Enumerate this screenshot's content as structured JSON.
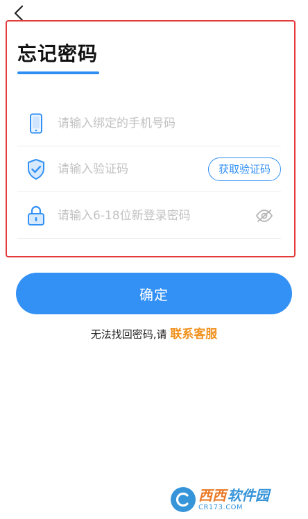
{
  "header": {
    "back_icon": "chevron-left-icon"
  },
  "page": {
    "title": "忘记密码"
  },
  "form": {
    "phone": {
      "icon": "phone-icon",
      "value": "",
      "placeholder": "请输入绑定的手机号码"
    },
    "code": {
      "icon": "shield-check-icon",
      "value": "",
      "placeholder": "请输入验证码",
      "button_label": "获取验证码"
    },
    "password": {
      "icon": "lock-icon",
      "value": "",
      "placeholder": "请输入6-18位新登录密码",
      "toggle_icon": "eye-off-icon"
    }
  },
  "actions": {
    "confirm_label": "确定"
  },
  "help": {
    "prefix": "无法找回密码,请 ",
    "link_label": "联系客服"
  },
  "watermark": {
    "brand_a": "西西",
    "brand_b": "软件园",
    "url": "CR173.COM"
  },
  "colors": {
    "accent": "#3391f5",
    "link": "#f0901c",
    "highlight_border": "#e43b3b"
  }
}
